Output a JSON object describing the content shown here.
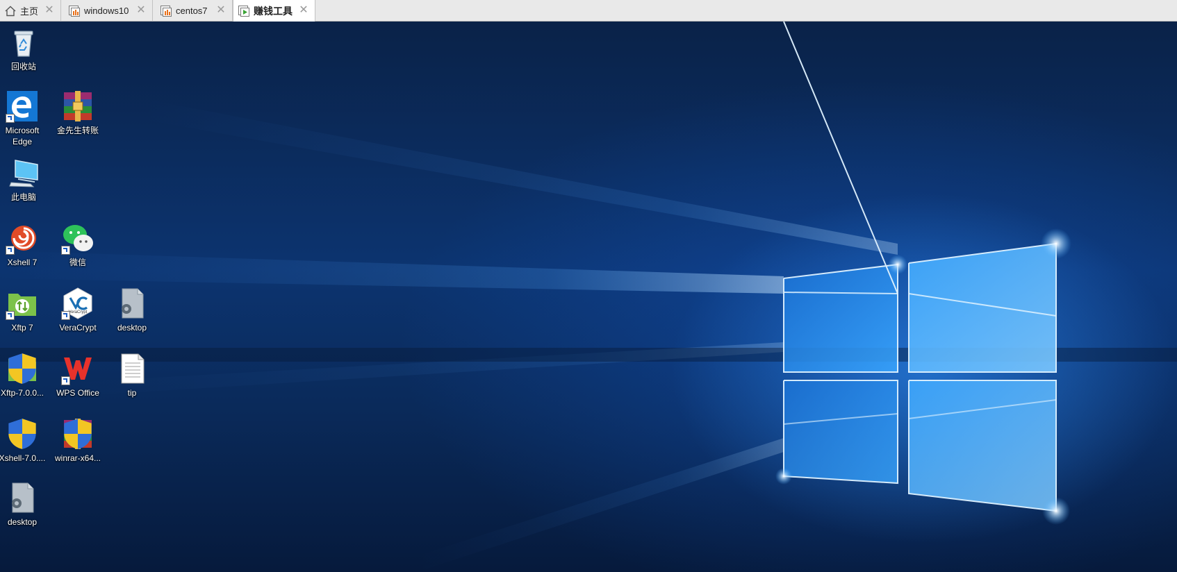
{
  "tabs": [
    {
      "label": "主页",
      "icon": "home-icon",
      "active": false
    },
    {
      "label": "windows10",
      "icon": "vm-icon",
      "active": false
    },
    {
      "label": "centos7",
      "icon": "vm-icon",
      "active": false
    },
    {
      "label": "赚钱工具",
      "icon": "vm-running-icon",
      "active": true
    }
  ],
  "tab_close_glyph": "✕",
  "colors": {
    "tabbar_bg": "#e9e9e9",
    "active_tab_bg": "#ffffff",
    "desktop_blue": "#0c3470",
    "window_glow": "#4db3ff"
  },
  "desktop": {
    "icons": [
      {
        "label": "回收站",
        "icon": "recycle-bin-icon"
      },
      {
        "label": "Microsoft Edge",
        "icon": "edge-icon"
      },
      {
        "label": "金先生转账",
        "icon": "winrar-icon"
      },
      {
        "label": "此电脑",
        "icon": "computer-icon"
      },
      {
        "label": "Xshell 7",
        "icon": "xshell-icon"
      },
      {
        "label": "微信",
        "icon": "wechat-icon"
      },
      {
        "label": "Xftp 7",
        "icon": "xftp-icon"
      },
      {
        "label": "VeraCrypt",
        "icon": "veracrypt-icon"
      },
      {
        "label": "desktop",
        "icon": "settings-file-icon"
      },
      {
        "label": "Xftp-7.0.0...",
        "icon": "xftp-installer-icon"
      },
      {
        "label": "WPS Office",
        "icon": "wps-icon"
      },
      {
        "label": "tip",
        "icon": "text-file-icon"
      },
      {
        "label": "Xshell-7.0....",
        "icon": "xshell-installer-icon"
      },
      {
        "label": "winrar-x64...",
        "icon": "winrar-installer-icon"
      },
      {
        "label": "desktop",
        "icon": "settings-file-icon"
      }
    ],
    "veracrypt_badge": "VeraCrypt"
  }
}
